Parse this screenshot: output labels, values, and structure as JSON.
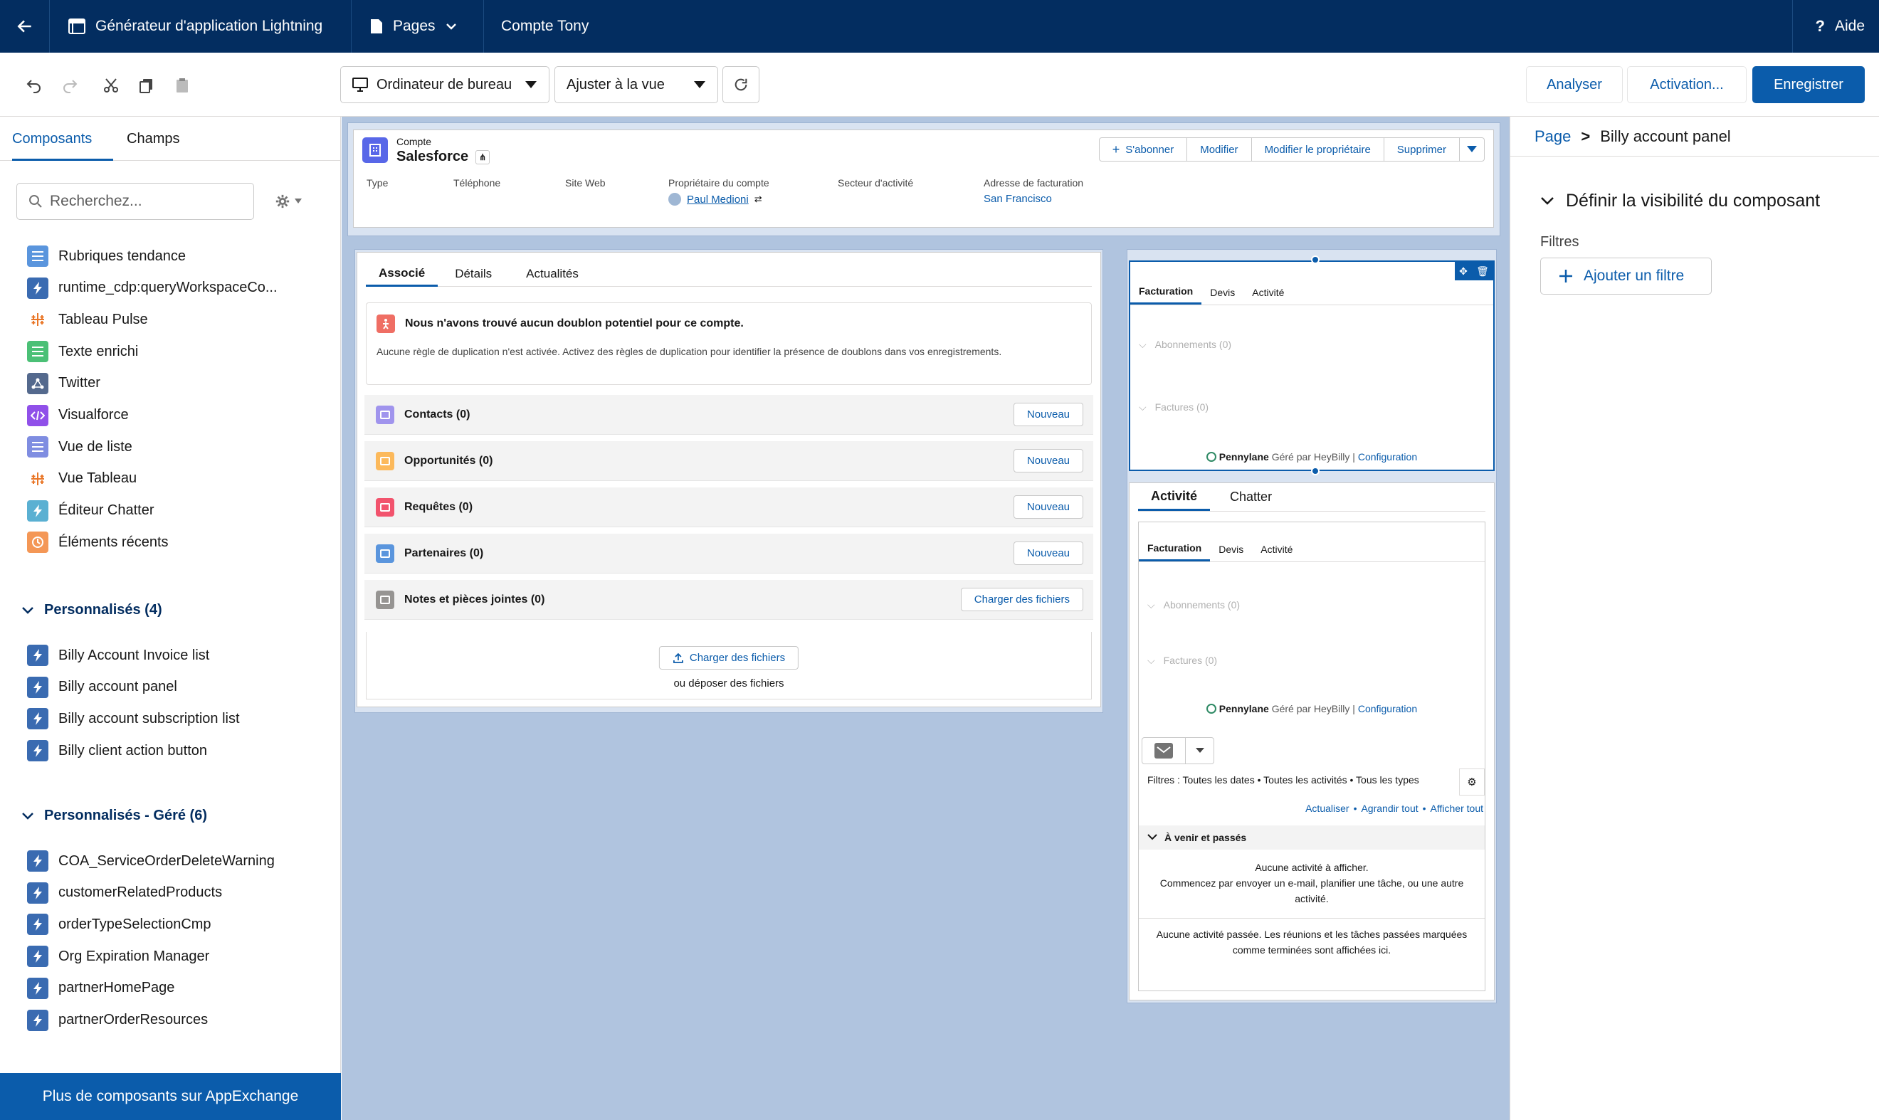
{
  "topbar": {
    "app_title": "Générateur d'application Lightning",
    "pages_label": "Pages",
    "record_label": "Compte Tony",
    "help_label": "Aide"
  },
  "toolbar": {
    "device_select": "Ordinateur de bureau",
    "zoom_select": "Ajuster à la vue",
    "analyze_label": "Analyser",
    "activation_label": "Activation...",
    "save_label": "Enregistrer"
  },
  "left_panel": {
    "tabs": [
      "Composants",
      "Champs"
    ],
    "search_placeholder": "Recherchez...",
    "standard_items": [
      {
        "label": "Rubriques tendance",
        "icon": "list-icon",
        "color": "#5a95dd"
      },
      {
        "label": "runtime_cdp:queryWorkspaceCo...",
        "icon": "lightning-icon",
        "color": "#3a6bb1"
      },
      {
        "label": "Tableau Pulse",
        "icon": "tableau-icon",
        "color": "#e97627"
      },
      {
        "label": "Texte enrichi",
        "icon": "rich-text-icon",
        "color": "#4bc076"
      },
      {
        "label": "Twitter",
        "icon": "twitter-icon",
        "color": "#54698d"
      },
      {
        "label": "Visualforce",
        "icon": "code-icon",
        "color": "#9050e9"
      },
      {
        "label": "Vue de liste",
        "icon": "list-view-icon",
        "color": "#7f8de1"
      },
      {
        "label": "Vue Tableau",
        "icon": "tableau-icon",
        "color": "#e97627"
      },
      {
        "label": "Éditeur Chatter",
        "icon": "chatter-icon",
        "color": "#5ab0d2"
      },
      {
        "label": "Éléments récents",
        "icon": "clock-icon",
        "color": "#f49756"
      }
    ],
    "group1_title": "Personnalisés (4)",
    "group1_items": [
      "Billy Account Invoice list",
      "Billy account panel",
      "Billy account subscription list",
      "Billy client action button"
    ],
    "group2_title": "Personnalisés - Géré (6)",
    "group2_items": [
      "COA_ServiceOrderDeleteWarning",
      "customerRelatedProducts",
      "orderTypeSelectionCmp",
      "Org Expiration Manager",
      "partnerHomePage",
      "partnerOrderResources"
    ],
    "appexchange_label": "Plus de composants sur AppExchange"
  },
  "record": {
    "object_label": "Compte",
    "name": "Salesforce",
    "actions": [
      "S'abonner",
      "Modifier",
      "Modifier le propriétaire",
      "Supprimer"
    ],
    "fields": [
      {
        "label": "Type",
        "value": ""
      },
      {
        "label": "Téléphone",
        "value": ""
      },
      {
        "label": "Site Web",
        "value": ""
      },
      {
        "label": "Propriétaire du compte",
        "value": "Paul Medioni"
      },
      {
        "label": "Secteur d'activité",
        "value": ""
      },
      {
        "label": "Adresse de facturation",
        "value": "San Francisco"
      }
    ]
  },
  "main_tabs": [
    "Associé",
    "Détails",
    "Actualités"
  ],
  "duplicate": {
    "title": "Nous n'avons trouvé aucun doublon potentiel pour ce compte.",
    "body": "Aucune règle de duplication n'est activée. Activez des règles de duplication pour identifier la présence de doublons dans vos enregistrements."
  },
  "related_lists": [
    {
      "label": "Contacts (0)",
      "button": "Nouveau",
      "color": "#a094ed"
    },
    {
      "label": "Opportunités (0)",
      "button": "Nouveau",
      "color": "#fcb95b"
    },
    {
      "label": "Requêtes (0)",
      "button": "Nouveau",
      "color": "#f2536d"
    },
    {
      "label": "Partenaires (0)",
      "button": "Nouveau",
      "color": "#5a95dd"
    },
    {
      "label": "Notes et pièces jointes (0)",
      "button": "Charger des fichiers",
      "color": "#969492"
    }
  ],
  "upload": {
    "button": "Charger des fichiers",
    "drop": "ou déposer des fichiers"
  },
  "billy_panel": {
    "tabs": [
      "Facturation",
      "Devis",
      "Activité"
    ],
    "sections": [
      "Abonnements (0)",
      "Factures (0)"
    ],
    "footer_brand": "Pennylane",
    "footer_managed": "Géré par HeyBilly |",
    "footer_link": "Configuration"
  },
  "activity_panel": {
    "tabs": [
      "Activité",
      "Chatter"
    ],
    "inner_tabs": [
      "Facturation",
      "Devis",
      "Activité"
    ],
    "sections": [
      "Abonnements (0)",
      "Factures (0)"
    ],
    "footer_brand": "Pennylane",
    "footer_managed": "Géré par HeyBilly |",
    "footer_link": "Configuration",
    "filters": "Filtres : Toutes les dates • Toutes les activités • Tous les types",
    "links": [
      "Actualiser",
      "Agrandir tout",
      "Afficher tout"
    ],
    "upcoming_title": "À venir et passés",
    "no_activity_1": "Aucune activité à afficher.",
    "no_activity_2": "Commencez par envoyer un e-mail, planifier une tâche, ou une autre activité.",
    "no_past": "Aucune activité passée. Les réunions et les tâches passées marquées comme terminées sont affichées ici."
  },
  "right_panel": {
    "breadcrumb_root": "Page",
    "breadcrumb_sep": ">",
    "breadcrumb_current": "Billy account panel",
    "section_title": "Définir la visibilité du composant",
    "filters_label": "Filtres",
    "add_filter_label": "Ajouter un filtre"
  }
}
